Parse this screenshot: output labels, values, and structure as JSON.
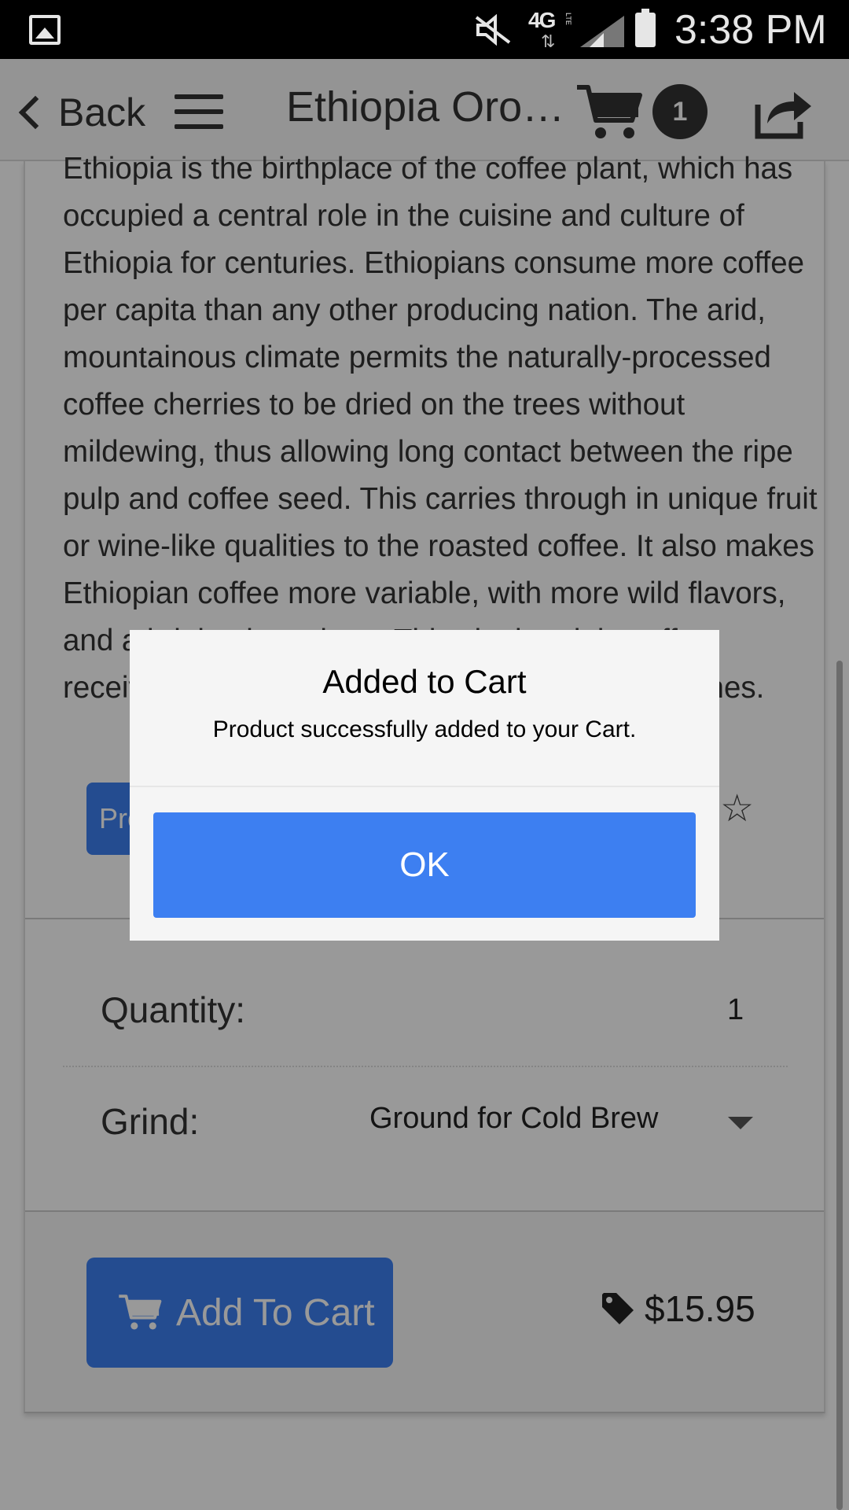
{
  "status_bar": {
    "network": "4G",
    "network_sub": "LTE",
    "time": "3:38 PM"
  },
  "header": {
    "back_label": "Back",
    "title": "Ethiopia Oro…",
    "cart_count": "1"
  },
  "product": {
    "description": "Ethiopia is the birthplace of the coffee plant, which has occupied a central role in the cuisine and culture of Ethiopia for centuries. Ethiopians consume more coffee per capita than any other producing nation. The arid, mountainous climate permits the naturally-processed coffee cherries to be dried on the trees without mildewing, thus allowing long contact between the ripe pulp and coffee seed. This carries through in unique fruit or wine-like qualities to the roasted coffee. It also makes Ethiopian coffee more variable, with more wild flavors, and a bright citrus tinge. This single origin coffee receives a light roast, to preserve the fruit-like tones.",
    "tag_button_label": "Product Details",
    "rating_stars": "☆☆☆☆☆",
    "rating_value": 0
  },
  "options": {
    "quantity_label": "Quantity:",
    "quantity_value": "1",
    "grind_label": "Grind:",
    "grind_value": "Ground for Cold Brew"
  },
  "footer": {
    "add_to_cart_label": "Add To Cart",
    "price": "$15.95"
  },
  "dialog": {
    "title": "Added to Cart",
    "message": "Product successfully added to your Cart.",
    "ok_label": "OK"
  },
  "colors": {
    "primary": "#3d7ff1",
    "header_bg": "#f7f7f7",
    "status_bar": "#000000",
    "dialog_bg": "#f5f5f5"
  }
}
